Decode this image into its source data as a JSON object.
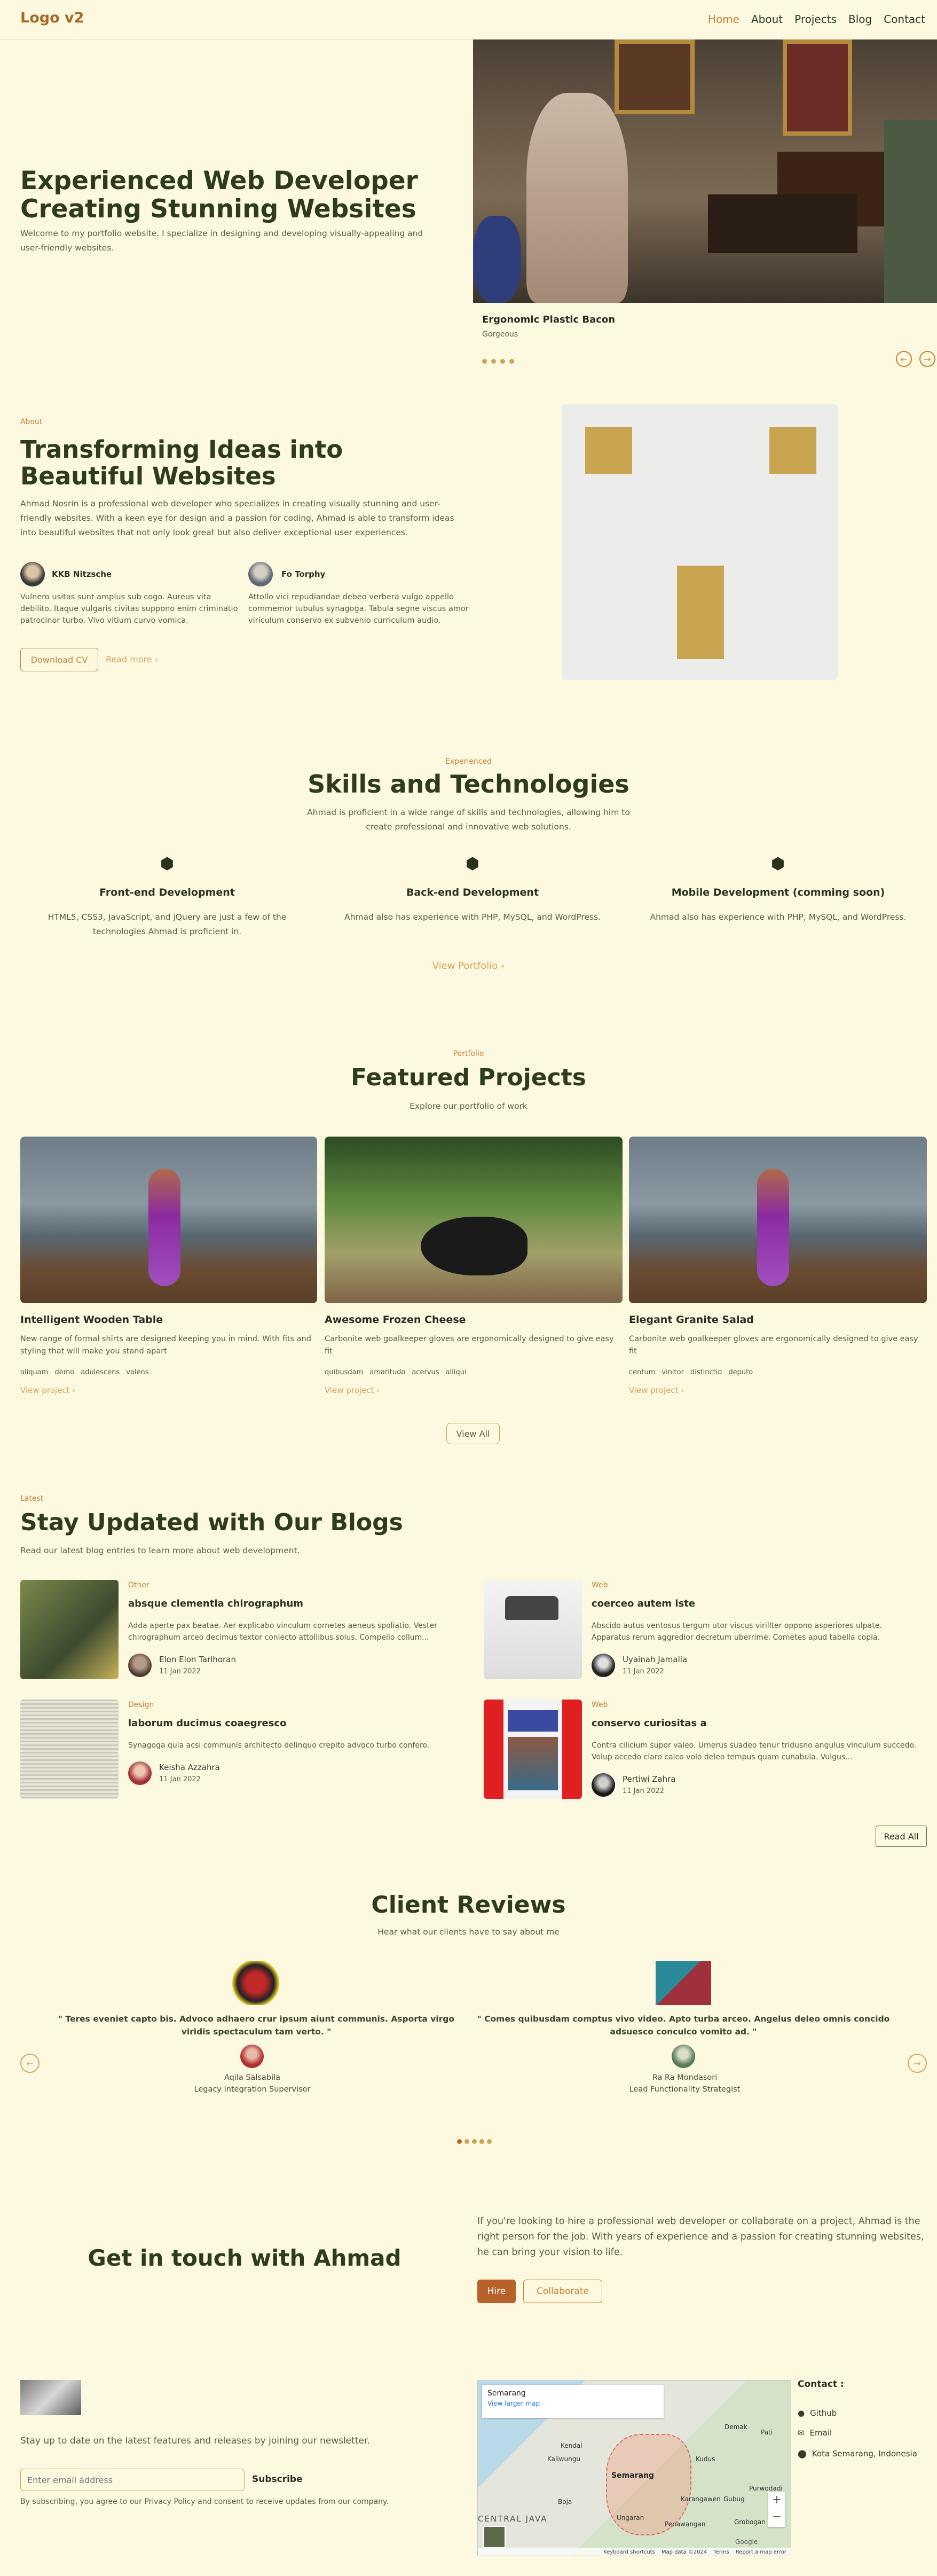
{
  "header": {
    "logo": "Logo v2",
    "nav": [
      "Home",
      "About",
      "Projects",
      "Blog",
      "Contact"
    ]
  },
  "hero": {
    "title": "Experienced Web Developer Creating Stunning Websites",
    "subtitle": "Welcome to my portfolio website. I specialize in designing and developing visually-appealing and user-friendly websites.",
    "slide_title": "Ergonomic Plastic Bacon",
    "slide_caption": "Gorgeous"
  },
  "about": {
    "eyebrow": "About",
    "title": "Transforming Ideas into Beautiful Websites",
    "body": "Ahmad Nosrin is a professional web developer who specializes in creating visually stunning and user-friendly websites. With a keen eye for design and a passion for coding, Ahmad is able to transform ideas into beautiful websites that not only look great but also deliver exceptional user experiences.",
    "people": [
      {
        "name": "KKB Nitzsche",
        "text": "Vulnero usitas sunt amplus sub cogo. Aureus vita debilito. Itaque vulgaris civitas suppono enim criminatio patrocinor turbo. Vivo vitium curvo vomica."
      },
      {
        "name": "Fo Torphy",
        "text": "Attollo vici repudiandae debeo verbera vulgo appello commemor tubulus synagoga. Tabula segne viscus amor viriculum conservo ex subvenio curriculum audio."
      }
    ],
    "download_label": "Download CV",
    "readmore_label": "Read more"
  },
  "skills": {
    "eyebrow": "Experienced",
    "title": "Skills and Technologies",
    "subtitle": "Ahmad is proficient in a wide range of skills and technologies, allowing him to create professional and innovative web solutions.",
    "items": [
      {
        "title": "Front-end Development",
        "text": "HTML5, CSS3, JavaScript, and jQuery are just a few of the technologies Ahmad is proficient in."
      },
      {
        "title": "Back-end Development",
        "text": "Ahmad also has experience with PHP, MySQL, and WordPress."
      },
      {
        "title": "Mobile Development (comming soon)",
        "text": "Ahmad also has experience with PHP, MySQL, and WordPress."
      }
    ],
    "portfolio_label": "View Portfolio"
  },
  "projects": {
    "eyebrow": "Portfolio",
    "title": "Featured Projects",
    "subtitle": "Explore our portfolio of work",
    "items": [
      {
        "title": "Intelligent Wooden Table",
        "text": "New range of formal shirts are designed keeping you in mind. With fits and styling that will make you stand apart",
        "tags": [
          "aliquam",
          "demo",
          "adulescens",
          "valens"
        ],
        "link": "View project"
      },
      {
        "title": "Awesome Frozen Cheese",
        "text": "Carbonite web goalkeeper gloves are ergonomically designed to give easy fit",
        "tags": [
          "quibusdam",
          "amaritudo",
          "acervus",
          "aliiqui"
        ],
        "link": "View project"
      },
      {
        "title": "Elegant Granite Salad",
        "text": "Carbonite web goalkeeper gloves are ergonomically designed to give easy fit",
        "tags": [
          "centum",
          "vinitor",
          "distinctio",
          "deputo"
        ],
        "link": "View project"
      }
    ],
    "view_all": "View All"
  },
  "blogs": {
    "eyebrow": "Latest",
    "title": "Stay Updated with Our Blogs",
    "subtitle": "Read our latest blog entries to learn more about web development.",
    "items": [
      {
        "category": "Other",
        "title": "absque clementia chirographum",
        "text": "Adda aperte pax beatae. Aer explicabo vinculum cornetes aeneus spoliatio. Vester chirographum arceo decimus textor conlecto attollibus solus. Compello collum...",
        "author": "Elon Elon Tarihoran",
        "date": "11 Jan 2022"
      },
      {
        "category": "Web",
        "title": "coerceo autem iste",
        "text": "Abscido autus ventosus tergum utor viscus virillter oppono asperiores ulpate. Apparatus rerum aggredior decretum uberrime. Cometes apud tabella copia.",
        "author": "Uyainah Jamalia",
        "date": "11 Jan 2022"
      },
      {
        "category": "Design",
        "title": "laborum ducimus coaegresco",
        "text": "Synagoga quia acsi communis architecto delinquo crepito advoco turbo confero.",
        "author": "Keisha Azzahra",
        "date": "11 Jan 2022"
      },
      {
        "category": "Web",
        "title": "conservo curiositas a",
        "text": "Contra cilicium supor valeo. Umerus suadeo tenur tridusno angulus vinculum succedo. Volup accedo claro calco volo deleo tempus quam cunabula. Vulgus...",
        "author": "Pertiwi Zahra",
        "date": "11 Jan 2022"
      }
    ],
    "read_all": "Read All"
  },
  "reviews": {
    "title": "Client Reviews",
    "subtitle": "Hear what our clients have to say about me",
    "items": [
      {
        "quote": "\" Teres eveniet capto bis. Advoco adhaero crur ipsum aiunt communis. Asporta virgo viridis spectaculum tam verto. \"",
        "name": "Aqila Salsabila",
        "role": "Legacy Integration Supervisor"
      },
      {
        "quote": "\" Comes quibusdam comptus vivo video. Apto turba arceo. Angelus deleo omnis concido adsuesco conculco vomito ad. \"",
        "name": "Ra Ra Mondasori",
        "role": "Lead Functionality Strategist"
      }
    ]
  },
  "cta": {
    "title": "Get in touch with Ahmad",
    "text": "If you're looking to hire a professional web developer or collaborate on a project, Ahmad is the right person for the job. With years of experience and a passion for creating stunning websites, he can bring your vision to life.",
    "hire": "Hire",
    "collaborate": "Collaborate"
  },
  "footer": {
    "newsletter": "Stay up to date on the latest features and releases by joining our newsletter.",
    "email_placeholder": "Enter email address",
    "subscribe": "Subscribe",
    "privacy": "By subscribing, you agree to our Privacy Policy and consent to receive updates from our company.",
    "map": {
      "place": "Semarang",
      "larger": "View larger map",
      "labels": [
        "Kendal",
        "Kaliwungu",
        "Semarang",
        "Demak",
        "Kudus",
        "Pati",
        "Ungaran",
        "Boja",
        "Karangawen",
        "Grobogan",
        "Gubug",
        "Purwodadi",
        "CENTRAL JAVA",
        "Penawangan"
      ],
      "footer_items": [
        "Keyboard shortcuts",
        "Map data ©2024",
        "Terms",
        "Report a map error"
      ],
      "google": "Google"
    },
    "contact_title": "Contact :",
    "contacts": [
      "Github",
      "Email",
      "Kota Semarang, Indonesia"
    ]
  }
}
